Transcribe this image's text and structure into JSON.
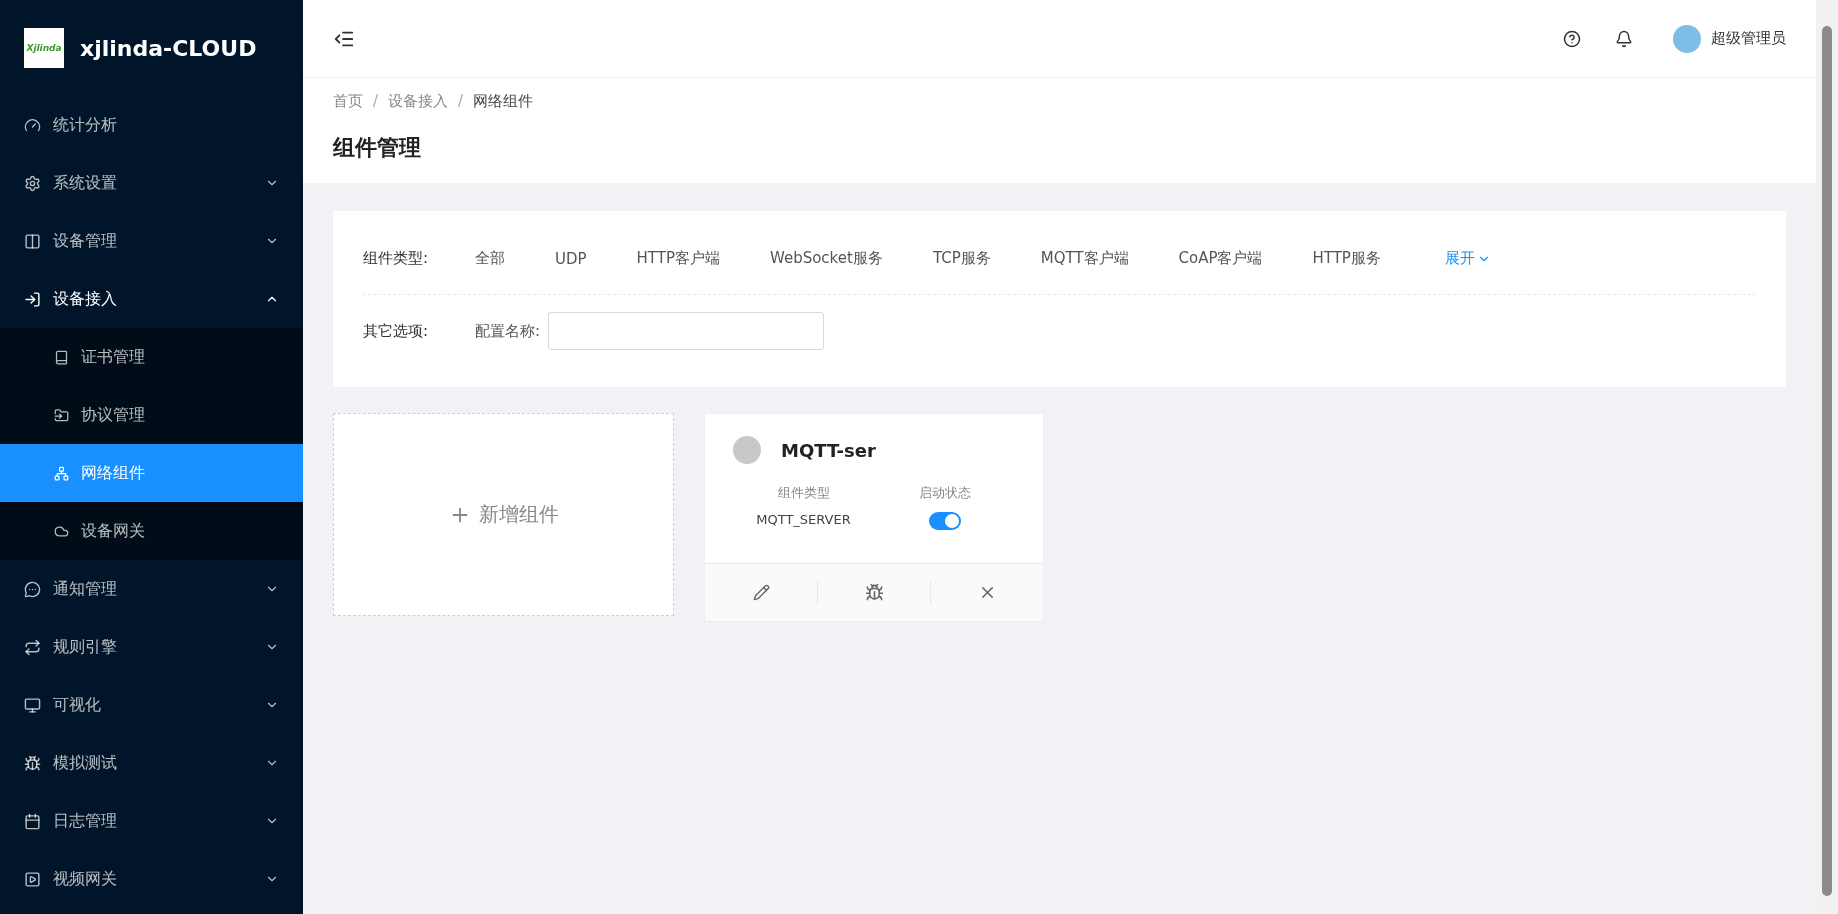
{
  "brand": {
    "logo": "Xjlinda",
    "name": "xjlinda-CLOUD"
  },
  "menu": [
    {
      "label": "统计分析",
      "kind": "link"
    },
    {
      "label": "系统设置",
      "kind": "submenu",
      "expanded": false
    },
    {
      "label": "设备管理",
      "kind": "submenu",
      "expanded": false
    },
    {
      "label": "设备接入",
      "kind": "submenu",
      "expanded": true,
      "children": [
        {
          "label": "证书管理",
          "selected": false
        },
        {
          "label": "协议管理",
          "selected": false
        },
        {
          "label": "网络组件",
          "selected": true
        },
        {
          "label": "设备网关",
          "selected": false
        }
      ]
    },
    {
      "label": "通知管理",
      "kind": "submenu",
      "expanded": false
    },
    {
      "label": "规则引擎",
      "kind": "submenu",
      "expanded": false
    },
    {
      "label": "可视化",
      "kind": "submenu",
      "expanded": false
    },
    {
      "label": "模拟测试",
      "kind": "submenu",
      "expanded": false
    },
    {
      "label": "日志管理",
      "kind": "submenu",
      "expanded": false
    },
    {
      "label": "视频网关",
      "kind": "submenu",
      "expanded": false
    }
  ],
  "header": {
    "user": "超级管理员"
  },
  "breadcrumb": [
    {
      "label": "首页"
    },
    {
      "separator": "/",
      "label": "设备接入"
    },
    {
      "separator": "/",
      "label": "网络组件"
    }
  ],
  "page_title": "组件管理",
  "filter": {
    "type_label": "组件类型:",
    "types": [
      "全部",
      "UDP",
      "HTTP客户端",
      "WebSocket服务",
      "TCP服务",
      "MQTT客户端",
      "CoAP客户端",
      "HTTP服务"
    ],
    "expand": "展开",
    "other_label": "其它选项:",
    "name_label": "配置名称:"
  },
  "add_card": "新增组件",
  "components": [
    {
      "name": "MQTT-ser",
      "color": "#c8c8c8",
      "type_label": "组件类型",
      "type": "MQTT_SERVER",
      "state_label": "启动状态",
      "on": true
    }
  ]
}
